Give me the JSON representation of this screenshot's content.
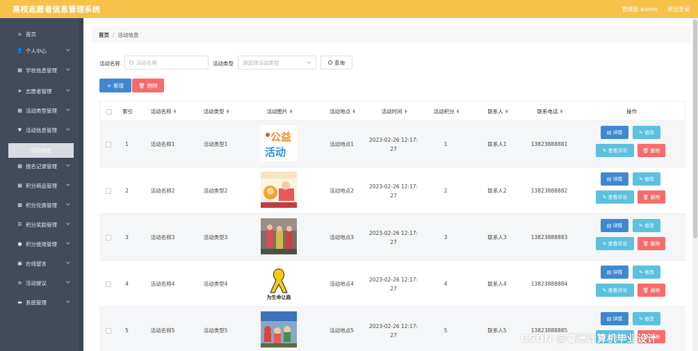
{
  "app": {
    "title": "高校志愿者信息管理系统",
    "admin_label": "管理员 admin",
    "logout_label": "退出登录"
  },
  "sidebar": {
    "items": [
      {
        "label": "首页",
        "icon": "home-icon",
        "glyph": "⌂"
      },
      {
        "label": "个人中心",
        "icon": "user-icon",
        "glyph": "👤"
      },
      {
        "label": "学校信息管理",
        "icon": "grid-icon",
        "glyph": "▦"
      },
      {
        "label": "志愿者管理",
        "icon": "send-icon",
        "glyph": "➤"
      },
      {
        "label": "活动类型管理",
        "icon": "grid-icon",
        "glyph": "▦"
      },
      {
        "label": "活动信息管理",
        "icon": "filter-icon",
        "glyph": "▼"
      },
      {
        "label": "报名记录管理",
        "icon": "grid-icon",
        "glyph": "▦"
      },
      {
        "label": "积分商品管理",
        "icon": "grid-icon",
        "glyph": "▦"
      },
      {
        "label": "积分兑换管理",
        "icon": "grid-icon",
        "glyph": "▦"
      },
      {
        "label": "积分奖励管理",
        "icon": "list-icon",
        "glyph": "☰"
      },
      {
        "label": "积分使用管理",
        "icon": "pin-icon",
        "glyph": "●"
      },
      {
        "label": "在线留言",
        "icon": "chat-icon",
        "glyph": "▣"
      },
      {
        "label": "活动提议",
        "icon": "sliders-icon",
        "glyph": "≡"
      },
      {
        "label": "系统管理",
        "icon": "monitor-icon",
        "glyph": "▬"
      }
    ],
    "active_sub": "活动信息"
  },
  "breadcrumb": {
    "home": "首页",
    "sep": "/",
    "current": "活动信息"
  },
  "search": {
    "name_label": "活动名称",
    "name_placeholder": "活动名称",
    "type_label": "活动类型",
    "type_placeholder": "请选择活动类型",
    "query_label": "查询"
  },
  "actions": {
    "add_label": "新增",
    "delete_label": "删除"
  },
  "table": {
    "headers": [
      "索引",
      "活动名称",
      "活动类型",
      "活动图片",
      "活动地点",
      "活动时间",
      "活动积分",
      "联系人",
      "联系电话",
      "操作"
    ],
    "ops": {
      "detail": "详情",
      "edit": "修改",
      "comments": "查看评论",
      "delete": "删除"
    },
    "rows": [
      {
        "index": "1",
        "name": "活动名称1",
        "type": "活动类型1",
        "place": "活动地点1",
        "time1": "2023-02-26 12:17:",
        "time2": "27",
        "points": "1",
        "contact": "联系人1",
        "phone": "13823888881",
        "image": "charity-text-logo"
      },
      {
        "index": "2",
        "name": "活动名称2",
        "type": "活动类型2",
        "place": "活动地点2",
        "time1": "2023-02-26 12:17:",
        "time2": "27",
        "points": "2",
        "contact": "联系人2",
        "phone": "13823888882",
        "image": "cartoon-poster"
      },
      {
        "index": "3",
        "name": "活动名称3",
        "type": "活动类型3",
        "place": "活动地点3",
        "time1": "2023-02-26 12:17:",
        "time2": "27",
        "points": "3",
        "contact": "联系人3",
        "phone": "13823888883",
        "image": "volunteer-photo"
      },
      {
        "index": "4",
        "name": "活动名称4",
        "type": "活动类型4",
        "place": "活动地点4",
        "time1": "2023-02-26 12:17:",
        "time2": "27",
        "points": "4",
        "contact": "联系人4",
        "phone": "13823888884",
        "image": "ribbon-poster"
      },
      {
        "index": "5",
        "name": "活动名称5",
        "type": "活动类型5",
        "place": "活动地点5",
        "time1": "2023-02-26 12:17:",
        "time2": "27",
        "points": "5",
        "contact": "联系人5",
        "phone": "13823888885",
        "image": "crowd-photo"
      }
    ]
  },
  "watermark": "CSDN @睿洲计算机毕业设计",
  "image_texts": {
    "charity_top": "公益",
    "charity_bottom": "活动",
    "ribbon_caption": "为生命让路"
  },
  "colors": {
    "topbar": "#f6c24a",
    "sidebar": "#414b5c",
    "primary": "#3f88d0",
    "danger": "#f56c6c",
    "info": "#5cc1de"
  }
}
